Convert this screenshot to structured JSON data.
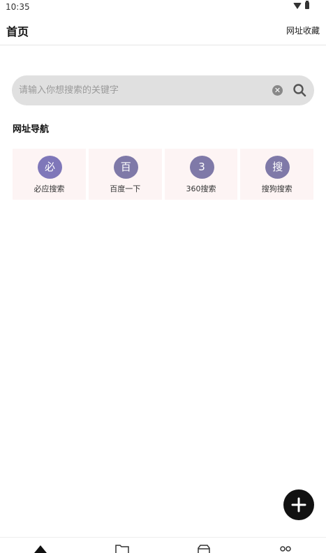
{
  "status_bar": {
    "time": "10:35"
  },
  "app_bar": {
    "title": "首页",
    "action": "网址收藏"
  },
  "search": {
    "placeholder": "请输入你想搜索的关键字",
    "value": "",
    "clear_glyph": "✕"
  },
  "section": {
    "title": "网址导航"
  },
  "nav_items": [
    {
      "icon_text": "必",
      "label": "必应搜索"
    },
    {
      "icon_text": "百",
      "label": "百度一下"
    },
    {
      "icon_text": "3",
      "label": "360搜索"
    },
    {
      "icon_text": "搜",
      "label": "搜狗搜索"
    }
  ],
  "colors": {
    "avatar": "#7f77b9",
    "card_bg": "#fdf4f4",
    "search_bg": "#e0e0e0",
    "fab": "#111111"
  },
  "icons": {
    "fab": "plus-icon",
    "bottom_nav": [
      "home-icon",
      "folder-icon",
      "box-icon",
      "more-icon"
    ]
  }
}
